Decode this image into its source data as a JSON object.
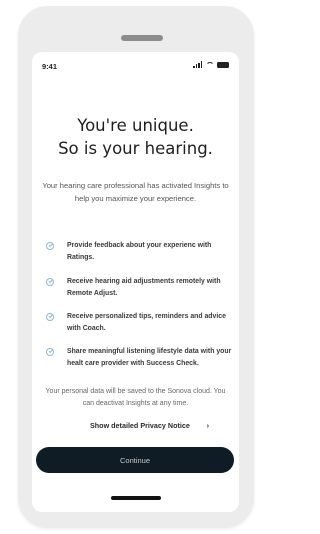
{
  "status_bar": {
    "time": "9:41",
    "signal_icon": "signal-icon",
    "wifi_icon": "wifi-icon",
    "battery_icon": "battery-icon"
  },
  "header": {
    "title_line1": "You're unique.",
    "title_line2": "So is your hearing."
  },
  "intro": "Your hearing care professional has activated Insights to help you maximize your experience.",
  "features": [
    {
      "icon": "check-circle-icon",
      "line1": "Provide feedback about your experienc with",
      "line2": "Ratings."
    },
    {
      "icon": "check-circle-icon",
      "line1": "Receive hearing aid adjustments remotely with",
      "line2": "Remote Adjust."
    },
    {
      "icon": "check-circle-icon",
      "line1": "Receive personalized tips, reminders and advice",
      "line2": "with Coach."
    },
    {
      "icon": "check-circle-icon",
      "line1": "Share meaningful listening lifestyle data with your",
      "line2": "healt care provider with Success Check."
    }
  ],
  "note": "Your personal data will be saved to the Sonova cloud. You can deactivat Insights at any time.",
  "privacy_link": {
    "label": "Show detailed Privacy Notice",
    "chevron": "›"
  },
  "continue_button": "Continue",
  "colors": {
    "accent": "#0f1c25",
    "icon": "#8fb8d4"
  }
}
